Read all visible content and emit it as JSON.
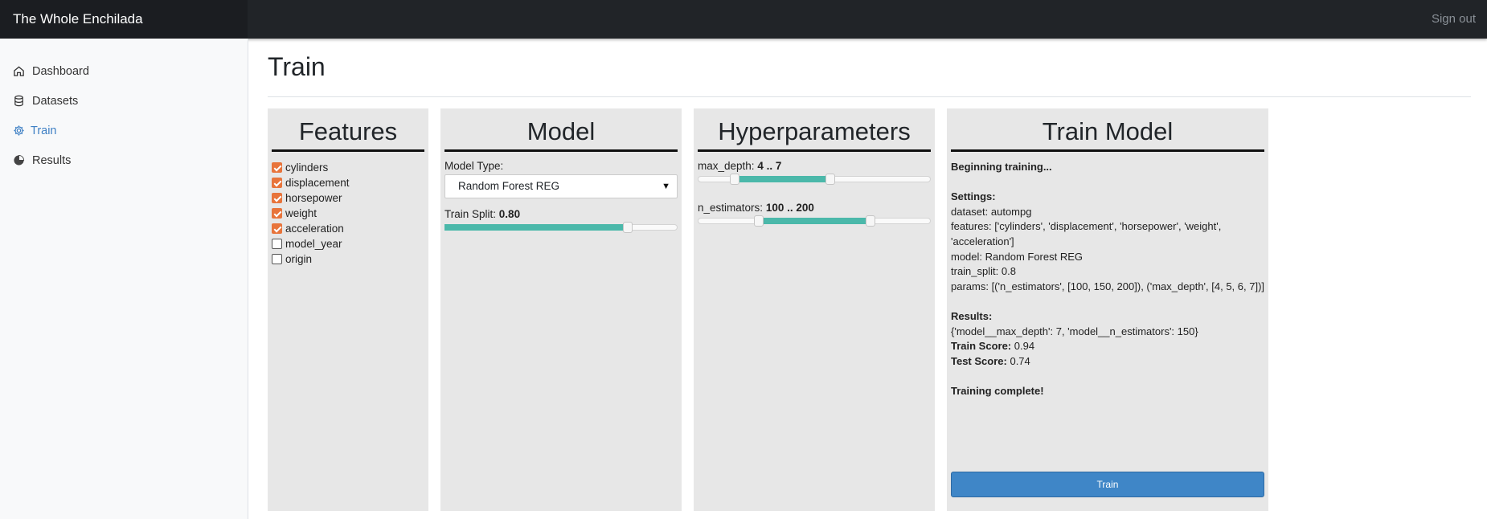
{
  "app": {
    "brand": "The Whole Enchilada",
    "signout": "Sign out"
  },
  "sidebar": {
    "items": [
      {
        "label": "Dashboard",
        "icon": "home-icon"
      },
      {
        "label": "Datasets",
        "icon": "database-icon"
      },
      {
        "label": "Train",
        "icon": "gear-icon",
        "active": true
      },
      {
        "label": "Results",
        "icon": "pie-chart-icon"
      }
    ]
  },
  "page": {
    "title": "Train"
  },
  "features": {
    "title": "Features",
    "items": [
      {
        "label": "cylinders",
        "checked": true
      },
      {
        "label": "displacement",
        "checked": true
      },
      {
        "label": "horsepower",
        "checked": true
      },
      {
        "label": "weight",
        "checked": true
      },
      {
        "label": "acceleration",
        "checked": true
      },
      {
        "label": "model_year",
        "checked": false
      },
      {
        "label": "origin",
        "checked": false
      }
    ]
  },
  "model": {
    "title": "Model",
    "type_label": "Model Type:",
    "type_value": "Random Forest REG",
    "split_label": "Train Split:",
    "split_value": "0.80",
    "split_fraction": 0.8
  },
  "hyperparameters": {
    "title": "Hyperparameters",
    "max_depth_label": "max_depth:",
    "max_depth_value": "4 .. 7",
    "max_depth_range": [
      4,
      7
    ],
    "n_estimators_label": "n_estimators:",
    "n_estimators_value": "100 .. 200",
    "n_estimators_range": [
      100,
      200
    ]
  },
  "train_model": {
    "title": "Train Model",
    "beginning": "Beginning training...",
    "settings_heading": "Settings:",
    "dataset": "dataset: autompg",
    "features": "features: ['cylinders', 'displacement', 'horsepower', 'weight', 'acceleration']",
    "model": "model: Random Forest REG",
    "train_split": "train_split: 0.8",
    "params": "params: [('n_estimators', [100, 150, 200]), ('max_depth', [4, 5, 6, 7])]",
    "results_heading": "Results:",
    "results": "{'model__max_depth': 7, 'model__n_estimators': 150}",
    "train_score_label": "Train Score:",
    "train_score_value": "0.94",
    "test_score_label": "Test Score:",
    "test_score_value": "0.74",
    "complete": "Training complete!",
    "button": "Train"
  },
  "colors": {
    "accent": "#3d7fc4",
    "checkbox": "#e8743b",
    "slider_fill": "#4bb8aa",
    "button": "#3f86c7"
  }
}
